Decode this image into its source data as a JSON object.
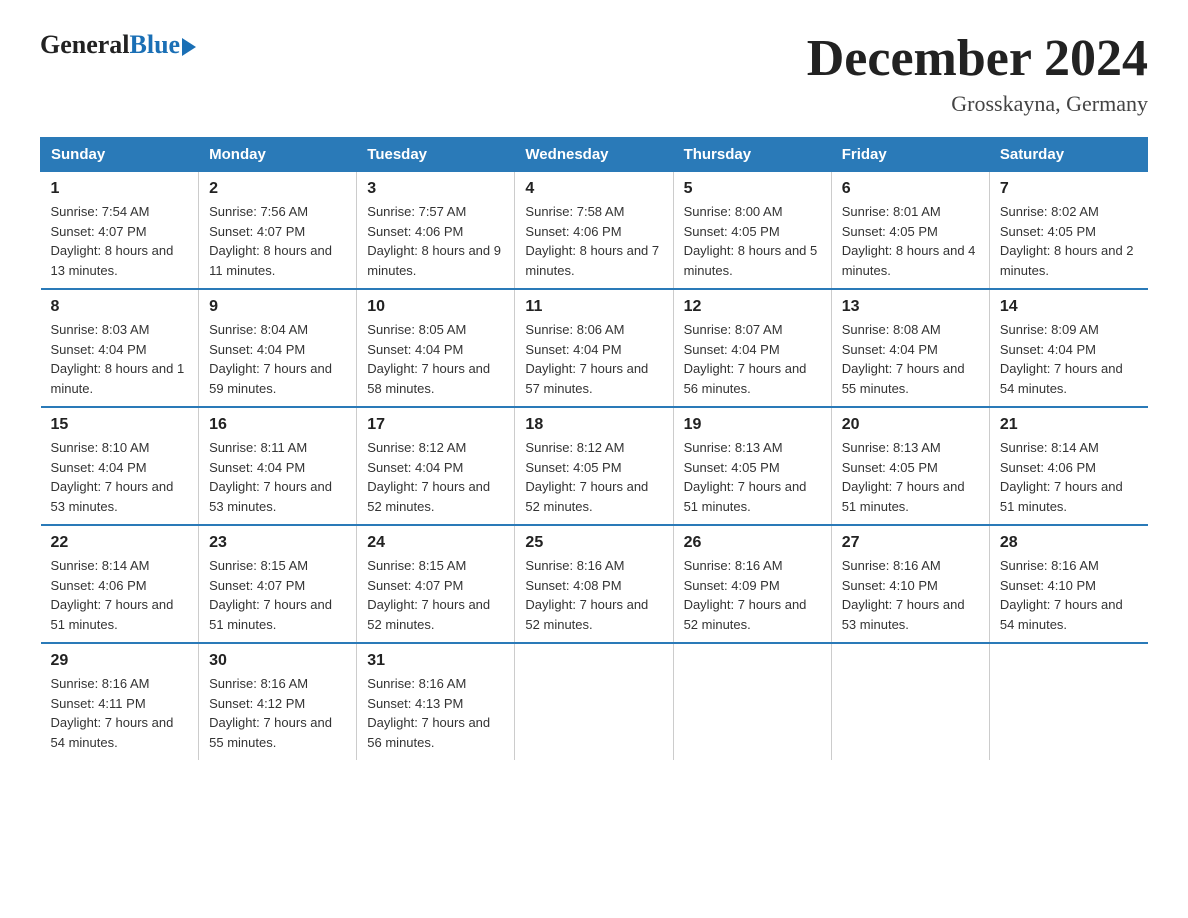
{
  "header": {
    "logo_general": "General",
    "logo_blue": "Blue",
    "title": "December 2024",
    "location": "Grosskayna, Germany"
  },
  "calendar": {
    "days_of_week": [
      "Sunday",
      "Monday",
      "Tuesday",
      "Wednesday",
      "Thursday",
      "Friday",
      "Saturday"
    ],
    "weeks": [
      [
        {
          "day": "1",
          "sunrise": "7:54 AM",
          "sunset": "4:07 PM",
          "daylight": "8 hours and 13 minutes."
        },
        {
          "day": "2",
          "sunrise": "7:56 AM",
          "sunset": "4:07 PM",
          "daylight": "8 hours and 11 minutes."
        },
        {
          "day": "3",
          "sunrise": "7:57 AM",
          "sunset": "4:06 PM",
          "daylight": "8 hours and 9 minutes."
        },
        {
          "day": "4",
          "sunrise": "7:58 AM",
          "sunset": "4:06 PM",
          "daylight": "8 hours and 7 minutes."
        },
        {
          "day": "5",
          "sunrise": "8:00 AM",
          "sunset": "4:05 PM",
          "daylight": "8 hours and 5 minutes."
        },
        {
          "day": "6",
          "sunrise": "8:01 AM",
          "sunset": "4:05 PM",
          "daylight": "8 hours and 4 minutes."
        },
        {
          "day": "7",
          "sunrise": "8:02 AM",
          "sunset": "4:05 PM",
          "daylight": "8 hours and 2 minutes."
        }
      ],
      [
        {
          "day": "8",
          "sunrise": "8:03 AM",
          "sunset": "4:04 PM",
          "daylight": "8 hours and 1 minute."
        },
        {
          "day": "9",
          "sunrise": "8:04 AM",
          "sunset": "4:04 PM",
          "daylight": "7 hours and 59 minutes."
        },
        {
          "day": "10",
          "sunrise": "8:05 AM",
          "sunset": "4:04 PM",
          "daylight": "7 hours and 58 minutes."
        },
        {
          "day": "11",
          "sunrise": "8:06 AM",
          "sunset": "4:04 PM",
          "daylight": "7 hours and 57 minutes."
        },
        {
          "day": "12",
          "sunrise": "8:07 AM",
          "sunset": "4:04 PM",
          "daylight": "7 hours and 56 minutes."
        },
        {
          "day": "13",
          "sunrise": "8:08 AM",
          "sunset": "4:04 PM",
          "daylight": "7 hours and 55 minutes."
        },
        {
          "day": "14",
          "sunrise": "8:09 AM",
          "sunset": "4:04 PM",
          "daylight": "7 hours and 54 minutes."
        }
      ],
      [
        {
          "day": "15",
          "sunrise": "8:10 AM",
          "sunset": "4:04 PM",
          "daylight": "7 hours and 53 minutes."
        },
        {
          "day": "16",
          "sunrise": "8:11 AM",
          "sunset": "4:04 PM",
          "daylight": "7 hours and 53 minutes."
        },
        {
          "day": "17",
          "sunrise": "8:12 AM",
          "sunset": "4:04 PM",
          "daylight": "7 hours and 52 minutes."
        },
        {
          "day": "18",
          "sunrise": "8:12 AM",
          "sunset": "4:05 PM",
          "daylight": "7 hours and 52 minutes."
        },
        {
          "day": "19",
          "sunrise": "8:13 AM",
          "sunset": "4:05 PM",
          "daylight": "7 hours and 51 minutes."
        },
        {
          "day": "20",
          "sunrise": "8:13 AM",
          "sunset": "4:05 PM",
          "daylight": "7 hours and 51 minutes."
        },
        {
          "day": "21",
          "sunrise": "8:14 AM",
          "sunset": "4:06 PM",
          "daylight": "7 hours and 51 minutes."
        }
      ],
      [
        {
          "day": "22",
          "sunrise": "8:14 AM",
          "sunset": "4:06 PM",
          "daylight": "7 hours and 51 minutes."
        },
        {
          "day": "23",
          "sunrise": "8:15 AM",
          "sunset": "4:07 PM",
          "daylight": "7 hours and 51 minutes."
        },
        {
          "day": "24",
          "sunrise": "8:15 AM",
          "sunset": "4:07 PM",
          "daylight": "7 hours and 52 minutes."
        },
        {
          "day": "25",
          "sunrise": "8:16 AM",
          "sunset": "4:08 PM",
          "daylight": "7 hours and 52 minutes."
        },
        {
          "day": "26",
          "sunrise": "8:16 AM",
          "sunset": "4:09 PM",
          "daylight": "7 hours and 52 minutes."
        },
        {
          "day": "27",
          "sunrise": "8:16 AM",
          "sunset": "4:10 PM",
          "daylight": "7 hours and 53 minutes."
        },
        {
          "day": "28",
          "sunrise": "8:16 AM",
          "sunset": "4:10 PM",
          "daylight": "7 hours and 54 minutes."
        }
      ],
      [
        {
          "day": "29",
          "sunrise": "8:16 AM",
          "sunset": "4:11 PM",
          "daylight": "7 hours and 54 minutes."
        },
        {
          "day": "30",
          "sunrise": "8:16 AM",
          "sunset": "4:12 PM",
          "daylight": "7 hours and 55 minutes."
        },
        {
          "day": "31",
          "sunrise": "8:16 AM",
          "sunset": "4:13 PM",
          "daylight": "7 hours and 56 minutes."
        },
        null,
        null,
        null,
        null
      ]
    ]
  }
}
